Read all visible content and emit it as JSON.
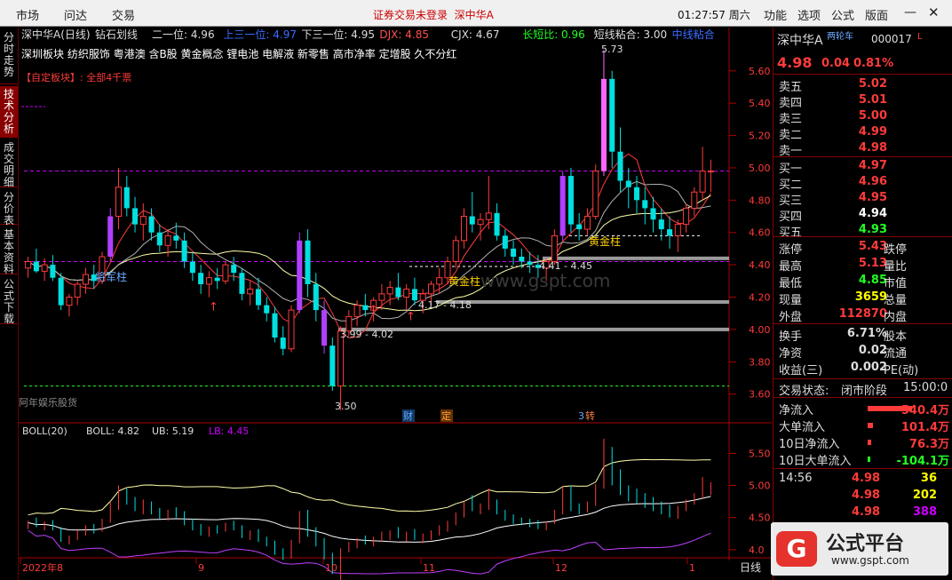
{
  "menu": {
    "market": "市场",
    "access": "问达",
    "trade": "交易",
    "status": "证券交易未登录",
    "stock_name": "深中华A",
    "clock": "01:27:57 周六",
    "func": "功能",
    "options": "选项",
    "formula": "公式",
    "layout": "版面"
  },
  "sidetabs": [
    "分时走势",
    "技术分析",
    "成交明细",
    "分价表",
    "基本资料",
    "公式下载"
  ],
  "header": {
    "title": "深中华A(日线)",
    "indicator": "钻石划线",
    "items": [
      {
        "text": "二一位: 4.96",
        "color": "#ddd"
      },
      {
        "text": "上三一位: 4.97",
        "color": "#3c6cff"
      },
      {
        "text": "下三一位: 4.95",
        "color": "#ddd"
      },
      {
        "text": "DJX: 4.85",
        "color": "#ff5050"
      },
      {
        "text": "CJX: 4.67",
        "color": "#ddd"
      },
      {
        "text": "长短比: 0.96",
        "color": "#2f2"
      },
      {
        "text": "短线粘合: 3.00",
        "color": "#ddd"
      },
      {
        "text": "中线粘合",
        "color": "#3c6cff"
      }
    ],
    "concepts": "深圳板块 纺织服饰 粤港澳 含B股 黄金概念 锂电池 电解液 新零售 高市净率 定增股 久不分红",
    "custom_block": "【自定板块】: 全部4千票"
  },
  "price_axis": [
    "5.60",
    "5.40",
    "5.20",
    "5.00",
    "4.80",
    "4.60",
    "4.40",
    "4.20",
    "4.00",
    "3.80",
    "3.60"
  ],
  "annotations": {
    "high": "5.73",
    "low": "3.50",
    "range1": "3.99 - 4.02",
    "range2": "4.17 - 4.18",
    "range3": "4.41 - 4.45",
    "gold1": "黄金柱",
    "gold2": "黄金柱",
    "general": "将军柱",
    "author": "阿年娱乐股货",
    "watermark": "www.gspt.com",
    "mark_cai": "财",
    "mark_ding": "定",
    "mark_num": "3",
    "mark_zhuan": "转"
  },
  "boll": {
    "label": "BOLL(20)",
    "boll": "BOLL: 4.82",
    "ub": "UB: 5.19",
    "lb": "LB: 4.45",
    "axis": [
      "5.50",
      "5.00",
      "4.50",
      "4.0"
    ]
  },
  "dates": [
    "2022年8",
    "9",
    "10",
    "11",
    "12",
    "1"
  ],
  "period": "日线",
  "quote": {
    "name": "深中华A",
    "tag": "两轮车",
    "code": "000017",
    "flag": "L",
    "price": "4.98",
    "change": "0.04",
    "pct": "0.81%"
  },
  "asks": [
    {
      "label": "卖五",
      "price": "5.02",
      "color": "#ff3b3b"
    },
    {
      "label": "卖四",
      "price": "5.01",
      "color": "#ff3b3b"
    },
    {
      "label": "卖三",
      "price": "5.00",
      "color": "#ff3b3b"
    },
    {
      "label": "卖二",
      "price": "4.99",
      "color": "#ff3b3b"
    },
    {
      "label": "卖一",
      "price": "4.98",
      "color": "#ff3b3b"
    }
  ],
  "bids": [
    {
      "label": "买一",
      "price": "4.97",
      "color": "#ff3b3b"
    },
    {
      "label": "买二",
      "price": "4.96",
      "color": "#ff3b3b"
    },
    {
      "label": "买三",
      "price": "4.95",
      "color": "#ff3b3b"
    },
    {
      "label": "买四",
      "price": "4.94",
      "color": "#ffffff"
    },
    {
      "label": "买五",
      "price": "4.93",
      "color": "#2f2"
    }
  ],
  "stats": [
    {
      "l1": "涨停",
      "v": "5.43",
      "c": "#ff3b3b",
      "l2": "跌停"
    },
    {
      "l1": "最高",
      "v": "5.13",
      "c": "#ff3b3b",
      "l2": "量比"
    },
    {
      "l1": "最低",
      "v": "4.85",
      "c": "#2f2",
      "l2": "市值"
    },
    {
      "l1": "现量",
      "v": "3659",
      "c": "#ff0",
      "l2": "总量"
    },
    {
      "l1": "外盘",
      "v": "112870",
      "c": "#ff3b3b",
      "l2": "内盘"
    }
  ],
  "stats2": [
    {
      "l1": "换手",
      "v": "6.71%",
      "c": "#ddd",
      "l2": "股本"
    },
    {
      "l1": "净资",
      "v": "0.02",
      "c": "#ddd",
      "l2": "流通"
    },
    {
      "l1": "收益(三)",
      "v": "0.002",
      "c": "#ddd",
      "l2": "PE(动)"
    }
  ],
  "trade_state": {
    "label": "交易状态:",
    "value": "闭市阶段",
    "time": "15:00:0"
  },
  "flows": [
    {
      "label": "净流入",
      "value": "540.4万",
      "color": "#ff3b3b"
    },
    {
      "label": "大单流入",
      "value": "101.4万",
      "color": "#ff3b3b"
    },
    {
      "label": "10日净流入",
      "value": "76.3万",
      "color": "#ff3b3b"
    },
    {
      "label": "10日大单流入",
      "value": "-104.1万",
      "color": "#2f2"
    }
  ],
  "ticks": [
    {
      "time": "14:56",
      "price": "4.98",
      "vol": "36",
      "vc": "#ff0"
    },
    {
      "time": "",
      "price": "4.98",
      "vol": "202",
      "vc": "#ff0"
    },
    {
      "time": "",
      "price": "4.98",
      "vol": "388",
      "vc": "#c0f"
    }
  ],
  "logo": {
    "mark": "G",
    "name": "公式平台",
    "url": "www.gspt.com"
  },
  "chart_data": {
    "type": "candlestick",
    "ylim": [
      3.45,
      5.78
    ],
    "candles": [
      [
        4.38,
        4.45,
        4.32,
        4.42
      ],
      [
        4.42,
        4.5,
        4.35,
        4.36
      ],
      [
        4.36,
        4.44,
        4.3,
        4.4
      ],
      [
        4.4,
        4.46,
        4.3,
        4.32
      ],
      [
        4.32,
        4.35,
        4.12,
        4.15
      ],
      [
        4.15,
        4.22,
        4.08,
        4.2
      ],
      [
        4.2,
        4.3,
        4.15,
        4.28
      ],
      [
        4.28,
        4.38,
        4.22,
        4.34
      ],
      [
        4.34,
        4.4,
        4.25,
        4.3
      ],
      [
        4.3,
        4.48,
        4.28,
        4.45
      ],
      [
        4.45,
        4.75,
        4.42,
        4.7
      ],
      [
        4.7,
        5.0,
        4.62,
        4.88
      ],
      [
        4.88,
        4.95,
        4.7,
        4.75
      ],
      [
        4.75,
        4.82,
        4.6,
        4.65
      ],
      [
        4.65,
        4.78,
        4.55,
        4.7
      ],
      [
        4.7,
        4.75,
        4.55,
        4.6
      ],
      [
        4.6,
        4.65,
        4.48,
        4.52
      ],
      [
        4.52,
        4.62,
        4.45,
        4.58
      ],
      [
        4.58,
        4.66,
        4.5,
        4.55
      ],
      [
        4.55,
        4.6,
        4.38,
        4.42
      ],
      [
        4.42,
        4.48,
        4.3,
        4.35
      ],
      [
        4.35,
        4.4,
        4.22,
        4.28
      ],
      [
        4.28,
        4.36,
        4.2,
        4.32
      ],
      [
        4.32,
        4.38,
        4.25,
        4.3
      ],
      [
        4.3,
        4.42,
        4.28,
        4.4
      ],
      [
        4.4,
        4.45,
        4.3,
        4.35
      ],
      [
        4.35,
        4.38,
        4.18,
        4.22
      ],
      [
        4.22,
        4.3,
        4.15,
        4.25
      ],
      [
        4.25,
        4.32,
        4.12,
        4.15
      ],
      [
        4.15,
        4.2,
        4.05,
        4.1
      ],
      [
        4.1,
        4.14,
        3.92,
        3.95
      ],
      [
        3.95,
        4.02,
        3.84,
        3.88
      ],
      [
        3.88,
        4.15,
        3.86,
        4.12
      ],
      [
        4.12,
        4.6,
        4.1,
        4.55
      ],
      [
        4.55,
        4.62,
        4.2,
        4.28
      ],
      [
        4.28,
        4.35,
        4.05,
        4.12
      ],
      [
        4.12,
        4.18,
        3.85,
        3.9
      ],
      [
        3.9,
        3.95,
        3.62,
        3.65
      ],
      [
        3.65,
        4.02,
        3.5,
        3.99
      ],
      [
        3.99,
        4.12,
        3.96,
        4.08
      ],
      [
        4.08,
        4.18,
        4.02,
        4.15
      ],
      [
        4.15,
        4.22,
        4.08,
        4.12
      ],
      [
        4.12,
        4.2,
        4.05,
        4.18
      ],
      [
        4.18,
        4.28,
        4.12,
        4.22
      ],
      [
        4.22,
        4.3,
        4.15,
        4.26
      ],
      [
        4.26,
        4.35,
        4.18,
        4.2
      ],
      [
        4.2,
        4.28,
        4.12,
        4.25
      ],
      [
        4.25,
        4.32,
        4.15,
        4.18
      ],
      [
        4.18,
        4.25,
        4.1,
        4.22
      ],
      [
        4.22,
        4.3,
        4.15,
        4.28
      ],
      [
        4.28,
        4.38,
        4.22,
        4.32
      ],
      [
        4.32,
        4.45,
        4.28,
        4.42
      ],
      [
        4.42,
        4.58,
        4.38,
        4.55
      ],
      [
        4.55,
        4.75,
        4.5,
        4.7
      ],
      [
        4.7,
        4.85,
        4.6,
        4.65
      ],
      [
        4.65,
        4.72,
        4.55,
        4.68
      ],
      [
        4.68,
        4.95,
        4.62,
        4.72
      ],
      [
        4.72,
        4.78,
        4.55,
        4.58
      ],
      [
        4.58,
        4.62,
        4.45,
        4.5
      ],
      [
        4.5,
        4.55,
        4.4,
        4.45
      ],
      [
        4.45,
        4.5,
        4.38,
        4.42
      ],
      [
        4.42,
        4.48,
        4.35,
        4.4
      ],
      [
        4.4,
        4.46,
        4.32,
        4.38
      ],
      [
        4.38,
        4.44,
        4.3,
        4.42
      ],
      [
        4.42,
        4.62,
        4.4,
        4.58
      ],
      [
        4.58,
        4.98,
        4.55,
        4.95
      ],
      [
        4.95,
        5.0,
        4.6,
        4.65
      ],
      [
        4.65,
        4.72,
        4.55,
        4.62
      ],
      [
        4.62,
        4.75,
        4.58,
        4.7
      ],
      [
        4.7,
        5.02,
        4.68,
        4.98
      ],
      [
        4.98,
        5.73,
        4.95,
        5.55
      ],
      [
        5.55,
        5.6,
        5.0,
        5.1
      ],
      [
        5.1,
        5.25,
        4.85,
        4.92
      ],
      [
        4.92,
        5.0,
        4.75,
        4.88
      ],
      [
        4.88,
        4.95,
        4.72,
        4.8
      ],
      [
        4.8,
        4.88,
        4.65,
        4.75
      ],
      [
        4.75,
        4.82,
        4.6,
        4.68
      ],
      [
        4.68,
        4.75,
        4.55,
        4.62
      ],
      [
        4.62,
        4.7,
        4.5,
        4.58
      ],
      [
        4.58,
        4.68,
        4.48,
        4.65
      ],
      [
        4.65,
        4.78,
        4.6,
        4.75
      ],
      [
        4.75,
        4.88,
        4.7,
        4.85
      ],
      [
        4.85,
        5.13,
        4.8,
        4.98
      ],
      [
        4.98,
        5.05,
        4.85,
        4.98
      ]
    ],
    "series": [
      {
        "name": "BOLL",
        "values": []
      },
      {
        "name": "UB",
        "values": []
      },
      {
        "name": "LB",
        "values": []
      }
    ]
  }
}
